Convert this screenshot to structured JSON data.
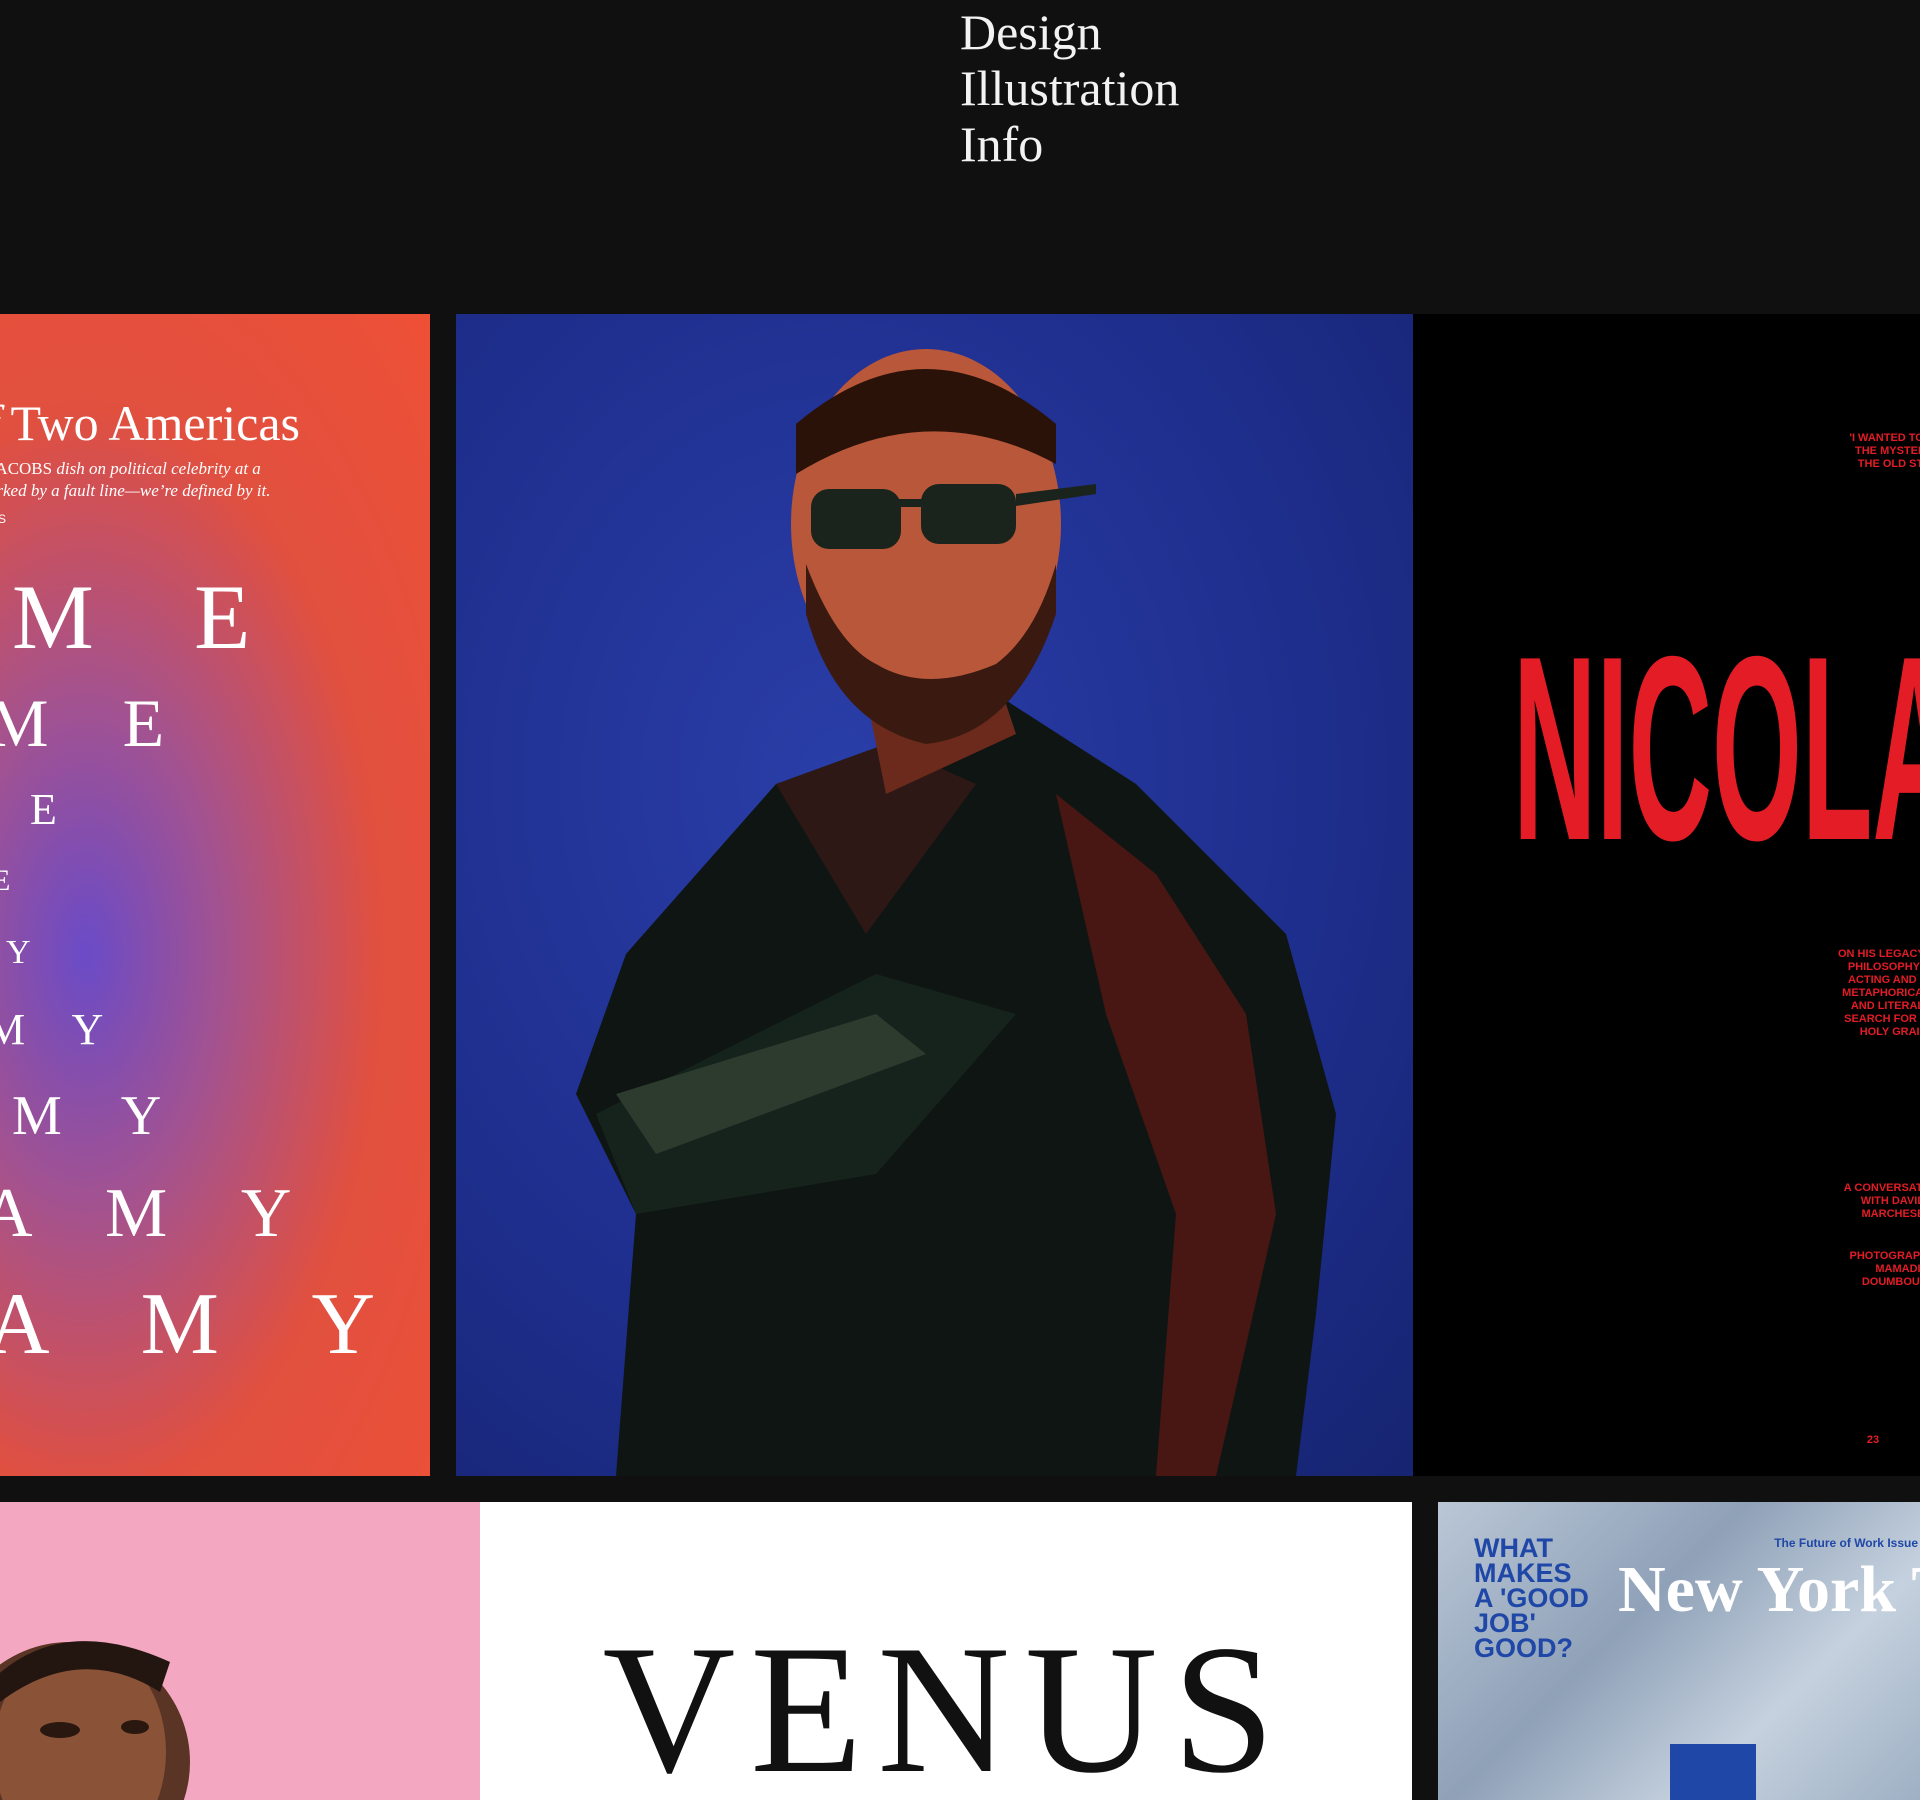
{
  "nav": {
    "items": [
      "Design",
      "Illustration",
      "Info"
    ]
  },
  "tiles": {
    "cover1": {
      "headline_italic": "of",
      "headline": " Two Americas",
      "dek_lead": "NN JACOBS ",
      "dek_line1": "dish on political celebrity at a",
      "dek_line2": "st marked by a fault line—we’re defined by it.",
      "byline": "OLMES",
      "rows": [
        "M E",
        "M  E",
        "E",
        "E",
        "Y",
        "M  Y",
        "M  Y",
        "A  M  Y",
        "A  M  Y"
      ]
    },
    "spread": {
      "quote": "'I WANTED TO HAVE THE MYSTERY OF THE OLD STARS'",
      "title": "NICOLAS",
      "deck": "ON HIS LEGACY, HIS PHILOSOPHY OF ACTING AND HIS METAPHORICAL —AND LITERAL— SEARCH FOR THE HOLY GRAIL",
      "credit1": "A CONVERSATION WITH DAVID MARCHESE",
      "credit2": "PHOTOGRAPH BY MAMADI DOUMBOUYA",
      "page": "23"
    },
    "venus": {
      "title": "VENUS"
    },
    "nyt": {
      "question": [
        "WHAT",
        "MAKES",
        "A 'GOOD",
        "JOB'",
        "GOOD?"
      ],
      "issue": "The Future of Work Issue",
      "masthead": "New York Times"
    }
  }
}
